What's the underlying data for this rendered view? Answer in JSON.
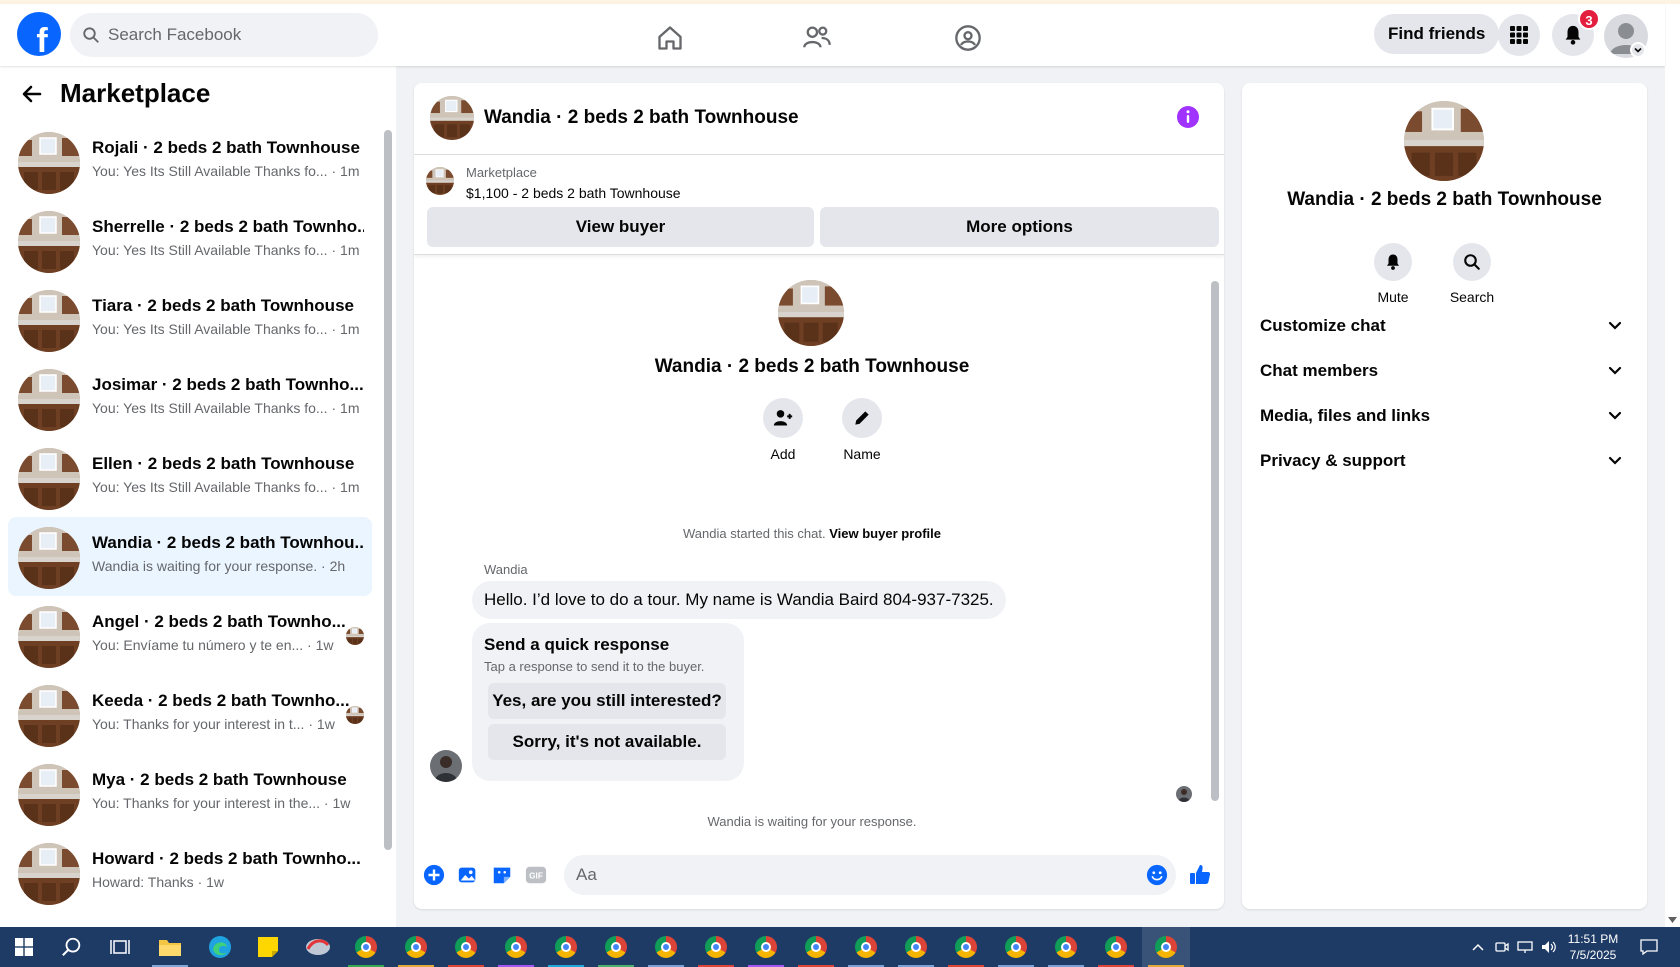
{
  "topbar": {
    "search_placeholder": "Search Facebook",
    "logo_letter": "f",
    "find_friends_label": "Find friends",
    "notification_count": "3"
  },
  "sidebar": {
    "title": "Marketplace",
    "conversations": [
      {
        "name": "Rojali · 2 beds 2 bath Townhouse",
        "preview": "You: Yes Its Still Available Thanks fo...",
        "time": "1m",
        "active": false
      },
      {
        "name": "Sherrelle · 2 beds 2 bath Townho...",
        "preview": "You: Yes Its Still Available Thanks fo...",
        "time": "1m",
        "active": false
      },
      {
        "name": "Tiara · 2 beds 2 bath Townhouse",
        "preview": "You: Yes Its Still Available Thanks fo...",
        "time": "1m",
        "active": false
      },
      {
        "name": "Josimar · 2 beds 2 bath Townho...",
        "preview": "You: Yes Its Still Available Thanks fo...",
        "time": "1m",
        "active": false
      },
      {
        "name": "Ellen · 2 beds 2 bath Townhouse",
        "preview": "You: Yes Its Still Available Thanks fo...",
        "time": "1m",
        "active": false
      },
      {
        "name": "Wandia · 2 beds 2 bath Townhou...",
        "preview": "Wandia is waiting for your response.",
        "time": "2h",
        "active": true
      },
      {
        "name": "Angel · 2 beds 2 bath Townho...",
        "preview": "You: Envíame tu número y te en...",
        "time": "1w",
        "active": false,
        "mini_avatar": true
      },
      {
        "name": "Keeda · 2 beds 2 bath Townho...",
        "preview": "You: Thanks for your interest in t...",
        "time": "1w",
        "active": false,
        "mini_avatar": true
      },
      {
        "name": "Mya · 2 beds 2 bath Townhouse",
        "preview": "You: Thanks for your interest in the...",
        "time": "1w",
        "active": false
      },
      {
        "name": "Howard · 2 beds 2 bath Townho...",
        "preview": "Howard: Thanks",
        "time": "1w",
        "active": false
      }
    ]
  },
  "chat": {
    "title": "Wandia · 2 beds 2 bath Townhouse",
    "marketplace_label": "Marketplace",
    "listing": "$1,100 - 2 beds 2 bath Townhouse",
    "view_buyer_label": "View buyer",
    "more_options_label": "More options",
    "profile_name": "Wandia · 2 beds 2 bath Townhouse",
    "add_label": "Add",
    "name_label": "Name",
    "started_text": "Wandia started this chat.",
    "view_profile_link": "View buyer profile",
    "sender": "Wandia",
    "message": "Hello. I’d love to do a tour. My name is Wandia Baird 804-937-7325.",
    "quick_title": "Send a quick response",
    "quick_subtitle": "Tap a response to send it to the buyer.",
    "quick_reply_1": "Yes, are you still interested?",
    "quick_reply_2": "Sorry, it's not available.",
    "waiting_text": "Wandia is waiting for your response.",
    "composer_placeholder": "Aa"
  },
  "details": {
    "name": "Wandia · 2 beds 2 bath Townhouse",
    "mute_label": "Mute",
    "search_label": "Search",
    "sections": [
      "Customize chat",
      "Chat members",
      "Media, files and links",
      "Privacy & support"
    ]
  },
  "taskbar": {
    "time": "11:51 PM",
    "date": "7/5/2025"
  },
  "colors": {
    "brand": "#0866ff",
    "active_row": "#ebf5ff",
    "badge": "#e41e3f",
    "info": "#a033ff",
    "taskbar": "#1e3b66"
  }
}
